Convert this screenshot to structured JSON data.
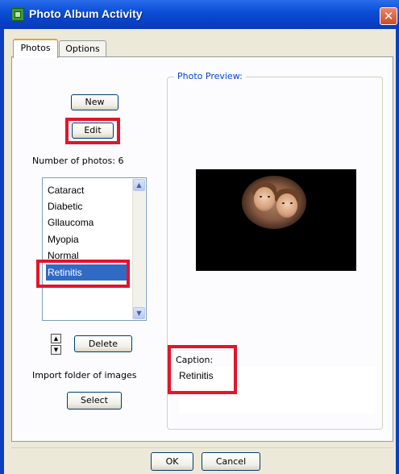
{
  "window": {
    "title": "Photo Album Activity",
    "close_symbol": "✕"
  },
  "tabs": [
    {
      "label": "Photos",
      "active": true
    },
    {
      "label": "Options",
      "active": false
    }
  ],
  "photos": {
    "new_label": "New",
    "edit_label": "Edit",
    "count_text": "Number of photos: 6",
    "items": [
      "Cataract",
      "Diabetic",
      "Gllaucoma",
      "Myopia",
      "Normal",
      "Retinitis"
    ],
    "selected": "Retinitis",
    "delete_label": "Delete",
    "import_text": "Import folder of images",
    "select_label": "Select",
    "move_up_symbol": "▲",
    "move_down_symbol": "▼",
    "scroll_up_symbol": "▲",
    "scroll_down_symbol": "▼"
  },
  "preview": {
    "group_label": "Photo Preview:",
    "caption_label": "Caption:",
    "caption_value": "Retinitis"
  },
  "footer": {
    "ok_label": "OK",
    "cancel_label": "Cancel"
  },
  "colors": {
    "highlight_box": "#e3142a",
    "selection": "#316ac5",
    "title_bar": "#0a4fd8",
    "group_label": "#0046d5"
  },
  "icons": {
    "app": "photo-album-icon",
    "close": "close-icon",
    "move_up": "arrow-up-icon",
    "move_down": "arrow-down-icon"
  }
}
